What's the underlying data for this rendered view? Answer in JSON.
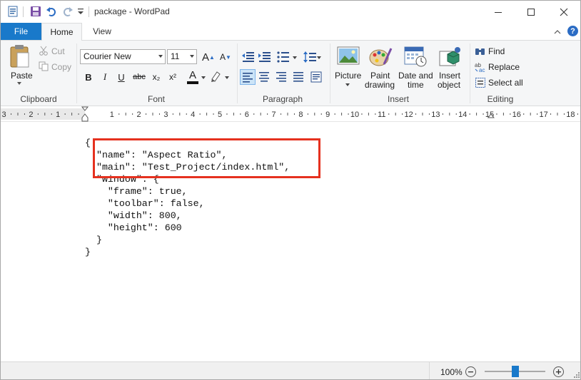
{
  "window": {
    "title": "package - WordPad",
    "controls": [
      "minimize",
      "maximize",
      "close"
    ]
  },
  "quick_access": [
    "wordpad-app-icon",
    "save-icon",
    "undo-icon",
    "redo-icon",
    "customize-dropdown-icon"
  ],
  "tabs": {
    "file": "File",
    "home": "Home",
    "view": "View"
  },
  "ribbon": {
    "clipboard": {
      "label": "Clipboard",
      "paste": "Paste",
      "cut": "Cut",
      "copy": "Copy"
    },
    "font": {
      "label": "Font",
      "family": "Courier New",
      "size": "11",
      "bold": "B",
      "italic": "I",
      "underline": "U",
      "strikethrough": "abc",
      "subscript": "x₂",
      "superscript": "x²",
      "text_color_letter": "A",
      "grow": "A",
      "shrink": "A"
    },
    "paragraph": {
      "label": "Paragraph"
    },
    "insert": {
      "label": "Insert",
      "picture": "Picture",
      "paint_drawing_1": "Paint",
      "paint_drawing_2": "drawing",
      "date_time_1": "Date and",
      "date_time_2": "time",
      "insert_object_1": "Insert",
      "insert_object_2": "object"
    },
    "editing": {
      "label": "Editing",
      "find": "Find",
      "replace": "Replace",
      "select_all": "Select all"
    }
  },
  "ruler": {
    "numbers": [
      "3",
      "2",
      "1",
      "1",
      "2",
      "3",
      "4",
      "5",
      "6",
      "7",
      "8",
      "9",
      "10",
      "11",
      "12",
      "13",
      "14",
      "15",
      "16",
      "17",
      "18"
    ]
  },
  "document": {
    "lines": [
      "{",
      "  \"name\": \"Aspect Ratio\",",
      "  \"main\": \"Test_Project/index.html\",",
      "  \"window\": {",
      "    \"frame\": true,",
      "    \"toolbar\": false,",
      "    \"width\": 800,",
      "    \"height\": 600",
      "  }",
      "}"
    ]
  },
  "status": {
    "zoom": "100%",
    "zoom_level": 1.0
  },
  "colors": {
    "file_tab": "#1979ca",
    "highlight_box": "#e5311f",
    "ribbon_bg": "#f5f6f7",
    "accent_blue": "#2b6cc4"
  }
}
